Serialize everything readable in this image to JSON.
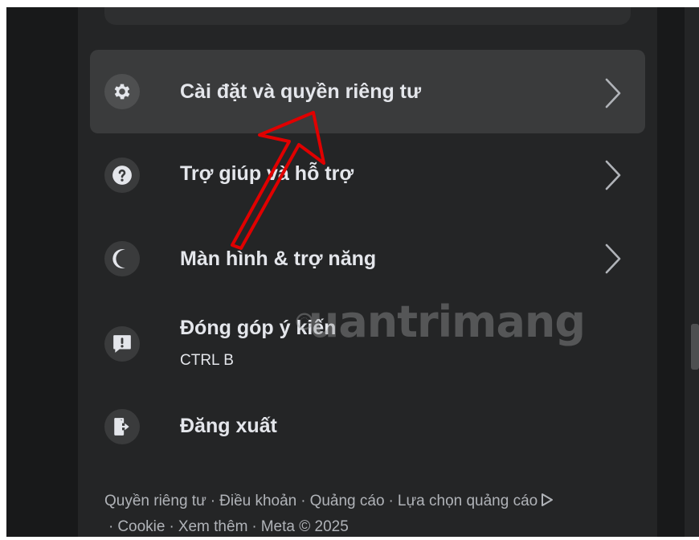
{
  "menu": {
    "items": [
      {
        "label": "Cài đặt và quyền riêng tư",
        "icon": "gear-icon",
        "has_chevron": true
      },
      {
        "label": "Trợ giúp và hỗ trợ",
        "icon": "question-icon",
        "has_chevron": true
      },
      {
        "label": "Màn hình & trợ năng",
        "icon": "moon-icon",
        "has_chevron": true
      },
      {
        "label": "Đóng góp ý kiến",
        "sublabel": "CTRL B",
        "icon": "feedback-icon",
        "has_chevron": false
      },
      {
        "label": "Đăng xuất",
        "icon": "logout-icon",
        "has_chevron": false
      }
    ]
  },
  "footer": {
    "privacy": "Quyền riêng tư",
    "terms": "Điều khoản",
    "ads": "Quảng cáo",
    "ad_choices": "Lựa chọn quảng cáo",
    "cookies": "Cookie",
    "more": "Xem thêm",
    "meta": "Meta © 2025",
    "separator": "·"
  },
  "watermark": {
    "text": "uantrimang"
  },
  "colors": {
    "panel_bg": "#242526",
    "item_hover_bg": "#3a3b3c",
    "text_primary": "#e4e6eb",
    "text_secondary": "#b0b3b8",
    "arrow_red": "#e00000"
  }
}
